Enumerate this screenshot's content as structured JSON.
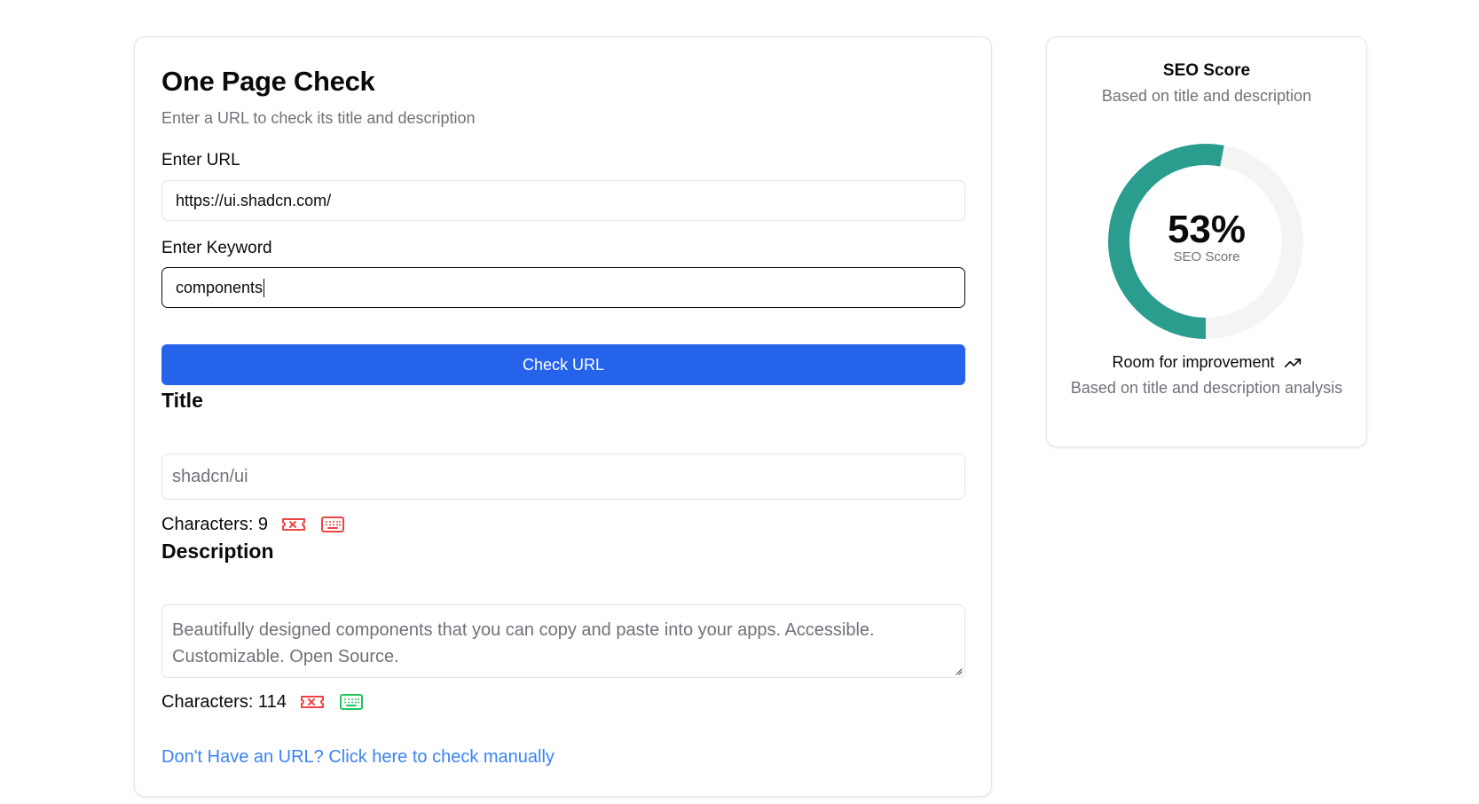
{
  "main": {
    "title": "One Page Check",
    "subtitle": "Enter a URL to check its title and description",
    "url_label": "Enter URL",
    "url_value": "https://ui.shadcn.com/",
    "keyword_label": "Enter Keyword",
    "keyword_value": "components",
    "check_button": "Check URL",
    "title_section": "Title",
    "title_value": "shadcn/ui",
    "title_char_label": "Characters: 9",
    "description_section": "Description",
    "description_value": "Beautifully designed components that you can copy and paste into your apps. Accessible. Customizable. Open Source.",
    "description_char_label": "Characters: 114",
    "manual_link": "Don't Have an URL? Click here to check manually"
  },
  "score": {
    "title": "SEO Score",
    "subtitle": "Based on title and description",
    "value": "53%",
    "percent": 53,
    "gauge_label": "SEO Score",
    "trend_text": "Room for improvement",
    "caption": "Based on title and description analysis",
    "color": "#2a9d8f",
    "track_color": "#f4f4f5"
  },
  "icons": {
    "title_keyword_status": "ticket-x-icon",
    "title_length_status": "keyboard-icon",
    "description_keyword_status": "ticket-x-icon",
    "description_length_status": "keyboard-icon",
    "trend": "trending-up-icon"
  },
  "colors": {
    "error": "#ef4444",
    "success": "#22c55e",
    "primary": "#2563eb",
    "link": "#3b82f6"
  }
}
